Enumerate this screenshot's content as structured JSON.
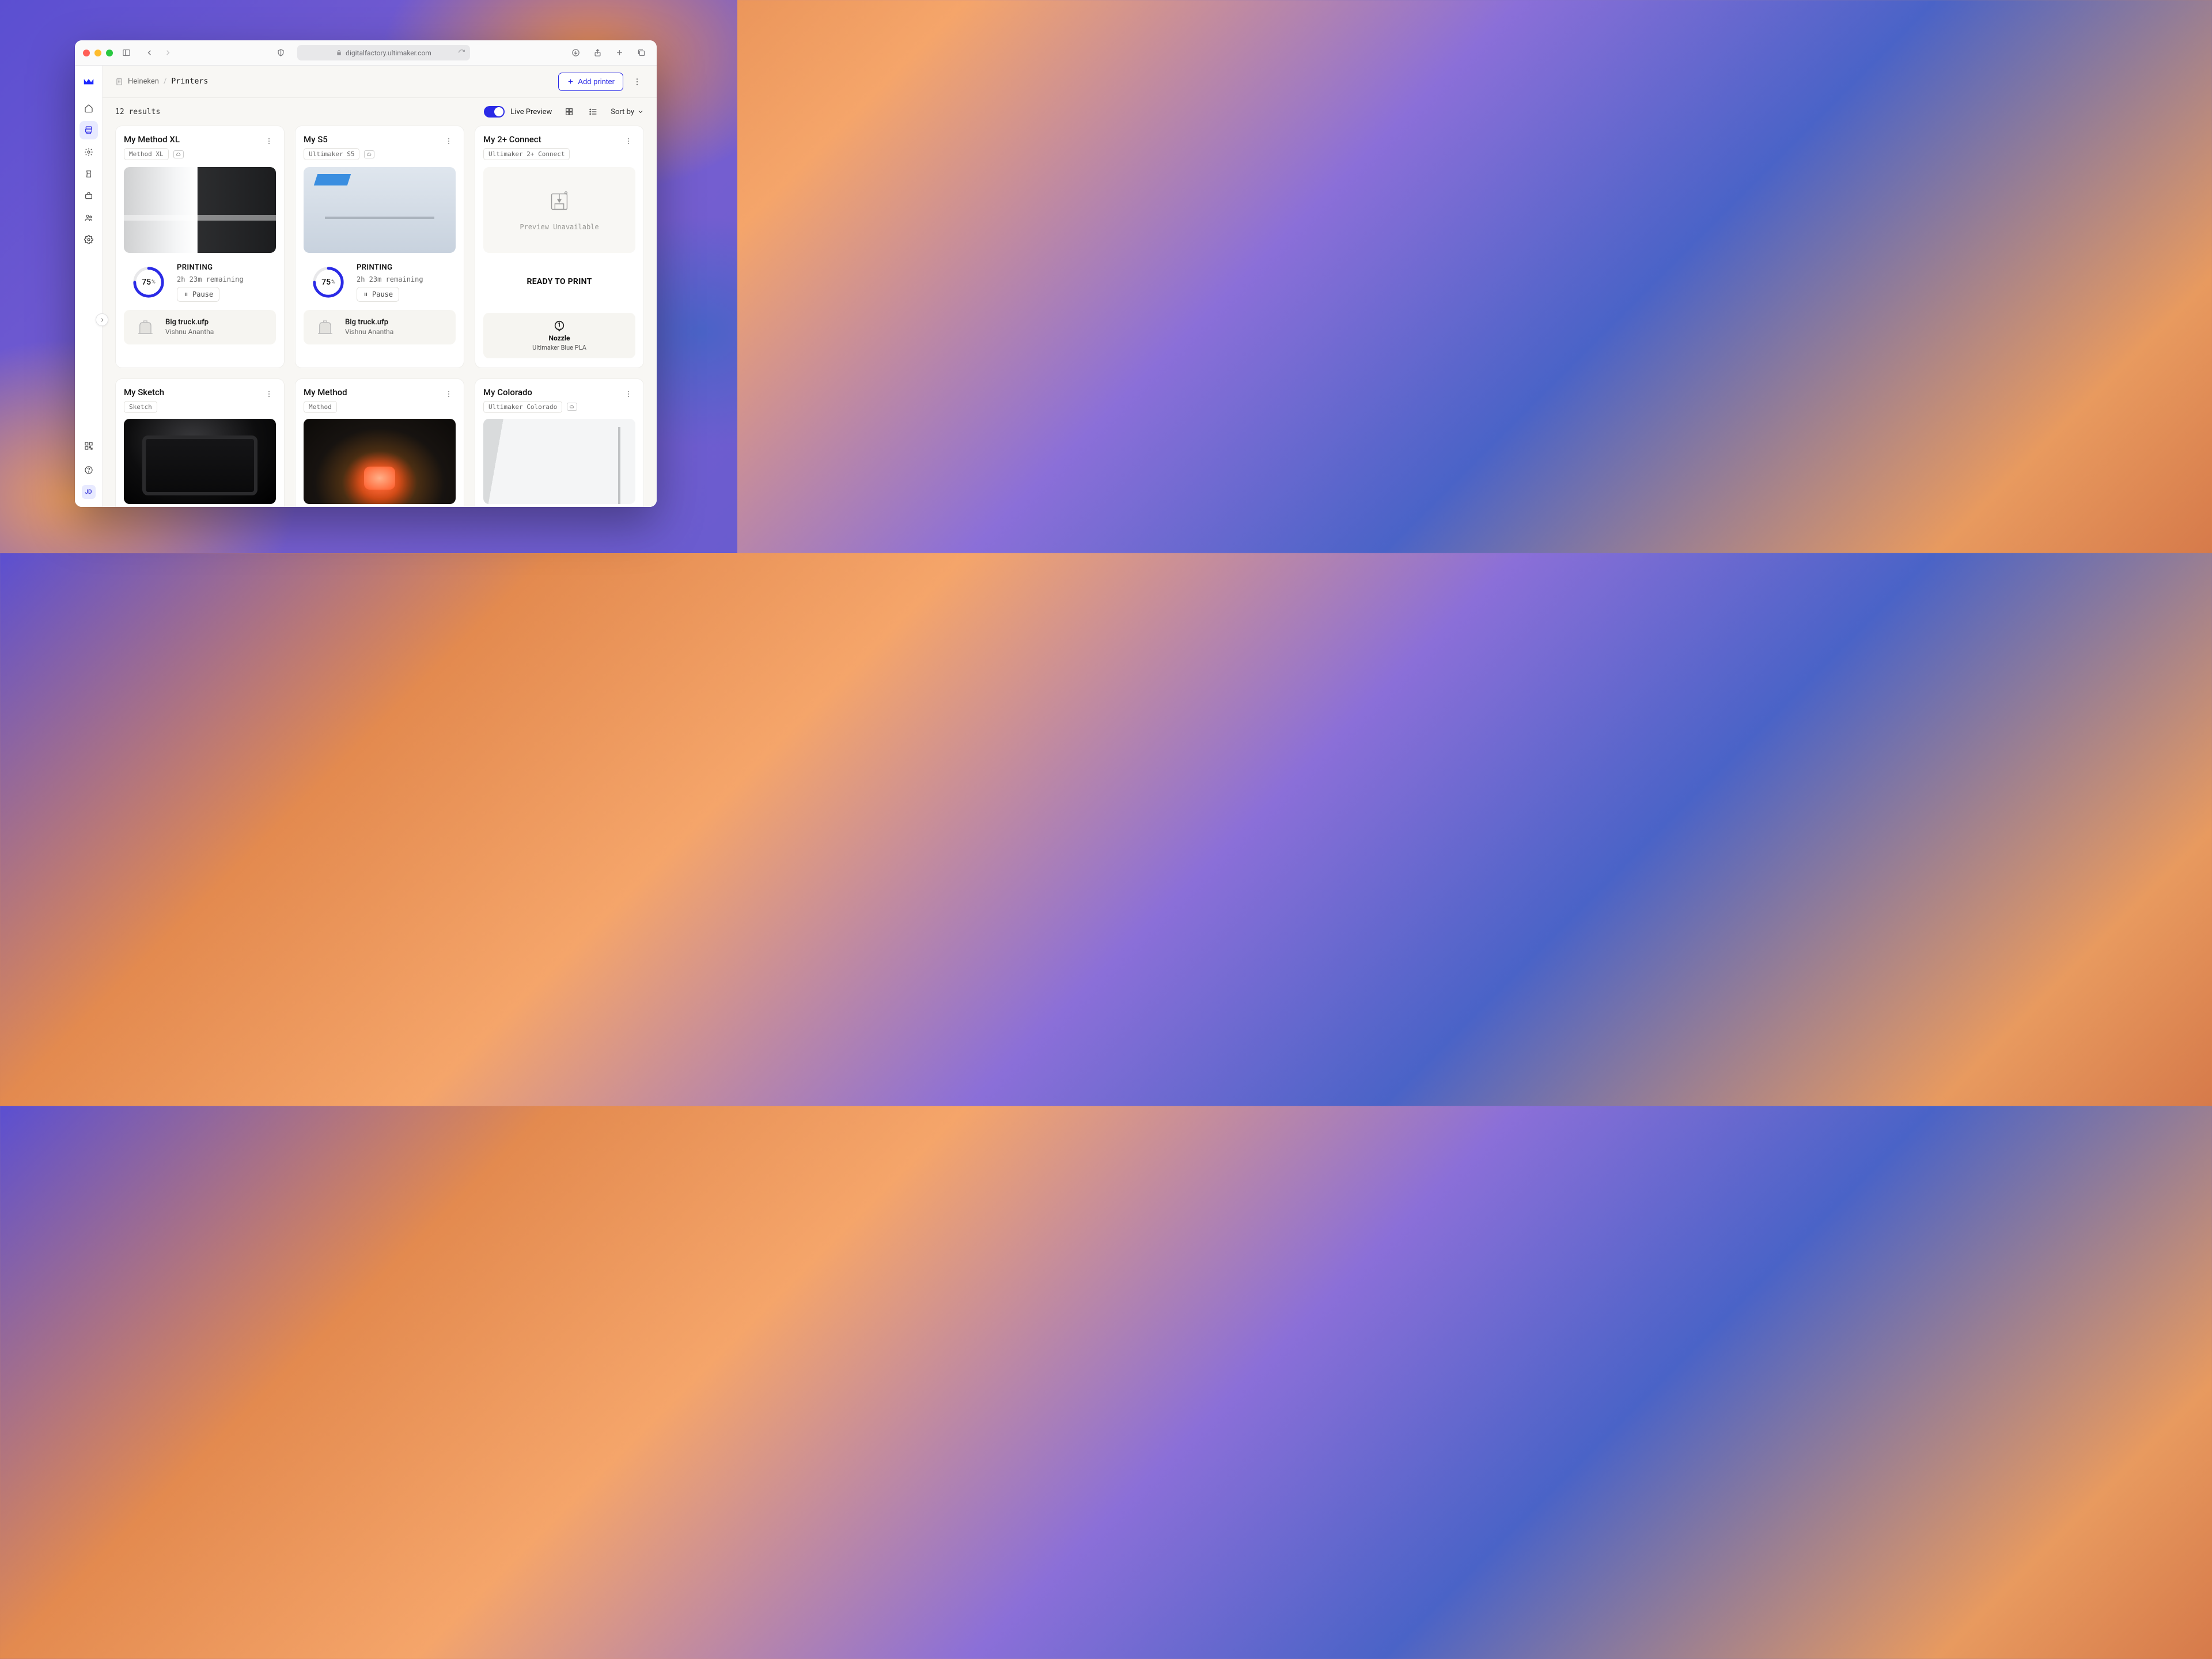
{
  "browser": {
    "url_display": "digitalfactory.ultimaker.com"
  },
  "breadcrumb": {
    "org": "Heineken",
    "page": "Printers"
  },
  "header": {
    "add_printer_label": "Add printer"
  },
  "toolbar": {
    "results_text": "12 results",
    "live_preview_label": "Live Preview",
    "sort_by_label": "Sort by"
  },
  "preview_unavailable_text": "Preview Unavailable",
  "pause_label": "Pause",
  "printers": [
    {
      "name": "My Method XL",
      "model": "Method XL",
      "status": "PRINTING",
      "progress_pct": 75,
      "time_remaining": "2h 23m remaining",
      "file": {
        "name": "Big truck.ufp",
        "owner": "Vishnu Anantha"
      }
    },
    {
      "name": "My S5",
      "model": "Ultimaker S5",
      "status": "PRINTING",
      "progress_pct": 75,
      "time_remaining": "2h 23m remaining",
      "file": {
        "name": "Big truck.ufp",
        "owner": "Vishnu Anantha"
      }
    },
    {
      "name": "My 2+ Connect",
      "model": "Ultimaker 2+ Connect",
      "status": "READY TO PRINT",
      "nozzle": {
        "label": "Nozzle",
        "material": "Ultimaker Blue PLA",
        "index": "1"
      }
    },
    {
      "name": "My Sketch",
      "model": "Sketch"
    },
    {
      "name": "My Method",
      "model": "Method"
    },
    {
      "name": "My Colorado",
      "model": "Ultimaker Colorado"
    }
  ],
  "user": {
    "initials": "JD"
  }
}
